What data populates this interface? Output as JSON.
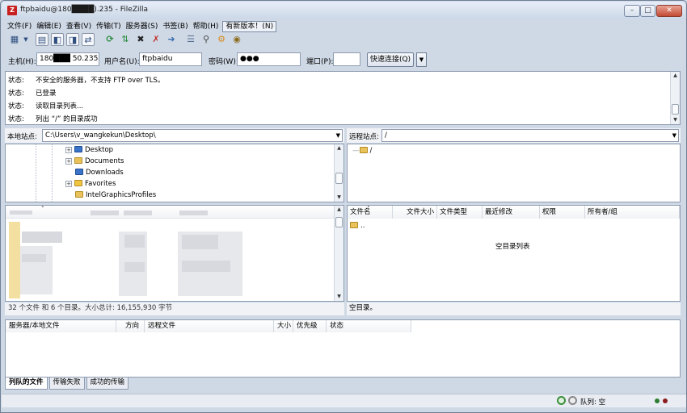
{
  "window": {
    "title": "ftpbaidu@180████).235 - FileZilla",
    "app_icon_letter": "Z",
    "minimize": "–",
    "maximize": "□",
    "close": "✕"
  },
  "menu": [
    "文件(F)",
    "编辑(E)",
    "查看(V)",
    "传输(T)",
    "服务器(S)",
    "书签(B)",
    "帮助(H)",
    "有新版本！(N)"
  ],
  "toolbar": {
    "icons": [
      "site-manager-icon",
      "dropdown-arrow-icon",
      "toggle-log-icon",
      "toggle-local-tree-icon",
      "toggle-remote-tree-icon",
      "toggle-queue-icon",
      "refresh-icon",
      "process-queue-icon",
      "cancel-icon",
      "disconnect-icon",
      "reconnect-icon",
      "filter-icon",
      "search-icon",
      "sync-browse-icon",
      "compare-icon"
    ],
    "colors": {
      "refresh": "#2a8a3e",
      "cancel": "#c0302a",
      "filter": "#556b8f"
    }
  },
  "quickconnect": {
    "host_label": "主机(H):",
    "host_value": "180███ 50.235",
    "user_label": "用户名(U):",
    "user_value": "ftpbaidu",
    "password_label": "密码(W):",
    "password_value": "●●●",
    "port_label": "端口(P):",
    "port_value": "",
    "button_label": "快速连接(Q)",
    "dropdown": "▼"
  },
  "log": {
    "lines": [
      {
        "label": "状态:",
        "text": "不安全的服务器，不支持 FTP over TLS。"
      },
      {
        "label": "状态:",
        "text": "已登录"
      },
      {
        "label": "状态:",
        "text": "读取目录列表..."
      },
      {
        "label": "状态:",
        "text": "列出 “/” 的目录成功"
      }
    ]
  },
  "local": {
    "site_label": "本地站点:",
    "path": "C:\\Users\\v_wangkekun\\Desktop\\",
    "tree": [
      "Desktop",
      "Documents",
      "Downloads",
      "Favorites",
      "IntelGraphicsProfiles"
    ],
    "status": "32 个文件 和 6 个目录。大小总计: 16,155,930 字节"
  },
  "remote": {
    "site_label": "远程站点:",
    "path": "/",
    "tree_root": "/",
    "columns": [
      "文件名",
      "文件大小",
      "文件类型",
      "最近修改",
      "权限",
      "所有者/组"
    ],
    "parent_entry": "..",
    "empty_text": "空目录列表",
    "status": "空目录。"
  },
  "queue": {
    "columns": [
      "服务器/本地文件",
      "方向",
      "远程文件",
      "大小",
      "优先级",
      "状态"
    ],
    "tabs": [
      "列队的文件",
      "传输失败",
      "成功的传输"
    ]
  },
  "statusbar": {
    "queue_label": "队列: 空"
  }
}
